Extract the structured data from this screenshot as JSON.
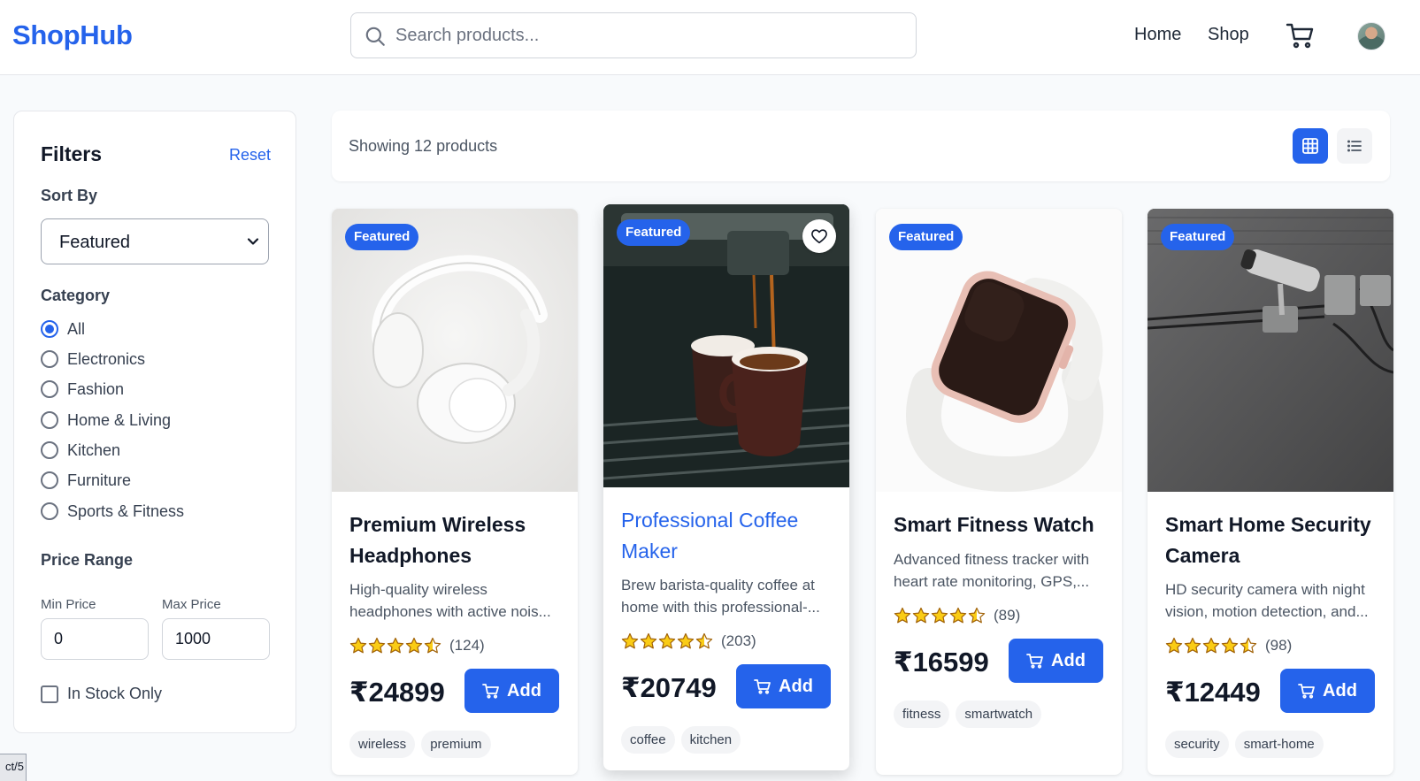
{
  "brand": {
    "name": "ShopHub",
    "color": "#2563eb"
  },
  "search": {
    "placeholder": "Search products...",
    "icon": "search-icon"
  },
  "nav": {
    "home": "Home",
    "shop": "Shop",
    "cart_icon": "cart-icon",
    "avatar_icon": "avatar"
  },
  "filters": {
    "title": "Filters",
    "reset": "Reset",
    "sort_label": "Sort By",
    "sort_value": "Featured",
    "category_label": "Category",
    "categories": [
      {
        "label": "All",
        "checked": true
      },
      {
        "label": "Electronics",
        "checked": false
      },
      {
        "label": "Fashion",
        "checked": false
      },
      {
        "label": "Home & Living",
        "checked": false
      },
      {
        "label": "Kitchen",
        "checked": false
      },
      {
        "label": "Furniture",
        "checked": false
      },
      {
        "label": "Sports & Fitness",
        "checked": false
      }
    ],
    "price_label": "Price Range",
    "min_label": "Min Price",
    "max_label": "Max Price",
    "min_value": "0",
    "max_value": "1000",
    "stock_label": "In Stock Only",
    "stock_checked": false
  },
  "toolbar": {
    "showing": "Showing 12 products",
    "grid_icon": "grid-icon",
    "list_icon": "list-icon",
    "active_view": "grid"
  },
  "products": [
    {
      "badge": "Featured",
      "title_line1": "Premium Wireless",
      "title_line2": "Headphones",
      "desc_line1": "High-quality wireless",
      "desc_line2": "headphones with active nois...",
      "rating": 4.5,
      "reviews": "(124)",
      "price": "₹24899",
      "add": "Add",
      "tags": [
        "wireless",
        "premium"
      ]
    },
    {
      "badge": "Featured",
      "title_line1": "Professional Coffee",
      "title_line2": "Maker",
      "desc_line1": "Brew barista-quality coffee at",
      "desc_line2": "home with this professional-...",
      "rating": 4.5,
      "reviews": "(203)",
      "price": "₹20749",
      "add": "Add",
      "tags": [
        "coffee",
        "kitchen"
      ],
      "hovered": true
    },
    {
      "badge": "Featured",
      "title_line1": "Smart Fitness Watch",
      "title_line2": "",
      "desc_line1": "Advanced fitness tracker with",
      "desc_line2": "heart rate monitoring, GPS,...",
      "rating": 4.5,
      "reviews": "(89)",
      "price": "₹16599",
      "add": "Add",
      "tags": [
        "fitness",
        "smartwatch"
      ]
    },
    {
      "badge": "Featured",
      "title_line1": "Smart Home Security",
      "title_line2": "Camera",
      "desc_line1": "HD security camera with night",
      "desc_line2": "vision, motion detection, and...",
      "rating": 4.5,
      "reviews": "(98)",
      "price": "₹12449",
      "add": "Add",
      "tags": [
        "security",
        "smart-home"
      ]
    }
  ],
  "status_chip": "ct/5"
}
